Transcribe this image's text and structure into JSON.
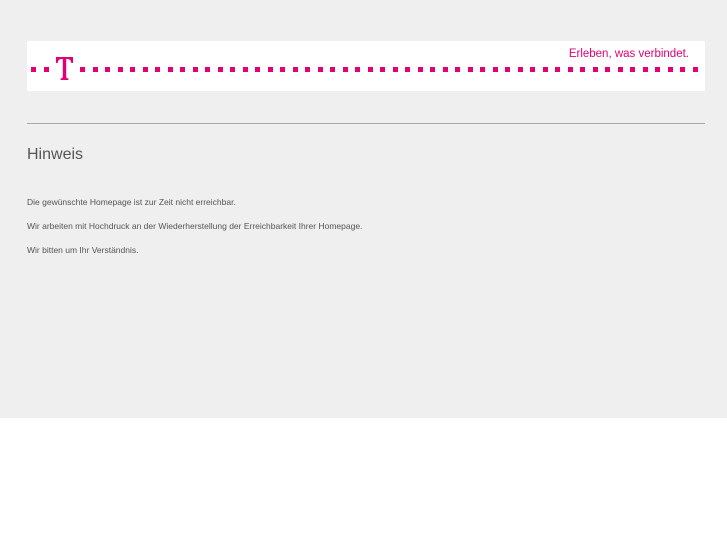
{
  "header": {
    "brand_color": "#e20074",
    "logo_icon": "telekom-t-icon",
    "slogan": "Erleben, was verbindet."
  },
  "main": {
    "title": "Hinweis",
    "messages": [
      "Die gewünschte Homepage ist zur Zeit nicht erreichbar.",
      "Wir arbeiten mit Hochdruck an der Wiederherstellung der Erreichbarkeit Ihrer Homepage.",
      "Wir bitten um Ihr Verständnis."
    ]
  }
}
